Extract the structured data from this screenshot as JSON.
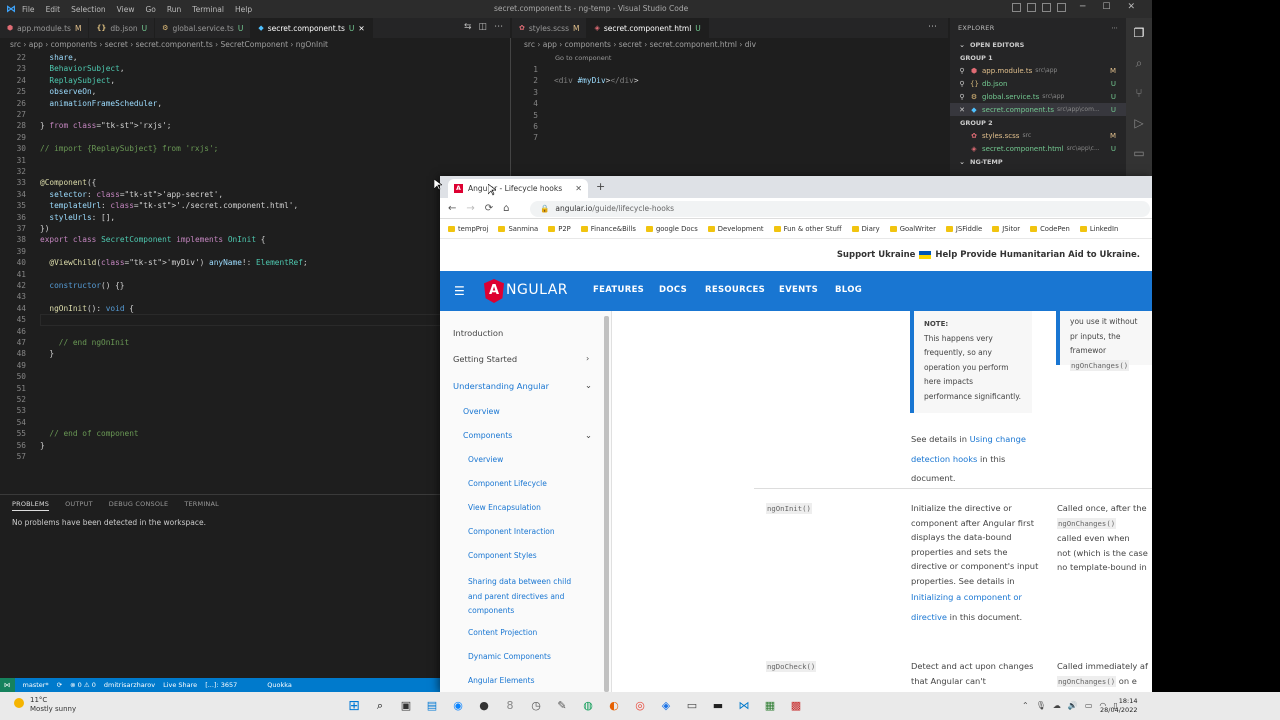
{
  "vscode": {
    "title": "secret.component.ts - ng-temp - Visual Studio Code",
    "menu": [
      "File",
      "Edit",
      "Selection",
      "View",
      "Go",
      "Run",
      "Terminal",
      "Help"
    ],
    "left_tabs": [
      {
        "label": "app.module.ts",
        "mark": "M",
        "color": "#e06c75",
        "icon": "angular-file-icon"
      },
      {
        "label": "db.json",
        "mark": "U",
        "color": "#d7ba7d",
        "icon": "json-file-icon"
      },
      {
        "label": "global.service.ts",
        "mark": "U",
        "color": "#e5c07b",
        "icon": "service-file-icon"
      },
      {
        "label": "secret.component.ts",
        "mark": "U",
        "color": "#4fc1ff",
        "icon": "component-file-icon"
      }
    ],
    "right_tabs": [
      {
        "label": "styles.scss",
        "mark": "M",
        "color": "#e06c75",
        "icon": "scss-file-icon"
      },
      {
        "label": "secret.component.html",
        "mark": "U",
        "color": "#e06c75",
        "icon": "html-file-icon"
      }
    ],
    "left_breadcrumb": "src › app › components › secret › secret.component.ts › SecretComponent › ngOnInit",
    "right_breadcrumb": "src › app › components › secret › secret.component.html › div",
    "go_to_component": "Go to component",
    "left_code": [
      {
        "n": "22",
        "t": "  share,"
      },
      {
        "n": "23",
        "t": "  BehaviorSubject,"
      },
      {
        "n": "24",
        "t": "  ReplaySubject,"
      },
      {
        "n": "25",
        "t": "  observeOn,"
      },
      {
        "n": "26",
        "t": "  animationFrameScheduler,"
      },
      {
        "n": "27",
        "t": ""
      },
      {
        "n": "28",
        "t": "} from 'rxjs';"
      },
      {
        "n": "29",
        "t": ""
      },
      {
        "n": "30",
        "t": "// import {ReplaySubject} from 'rxjs';"
      },
      {
        "n": "31",
        "t": ""
      },
      {
        "n": "32",
        "t": ""
      },
      {
        "n": "33",
        "t": "@Component({"
      },
      {
        "n": "34",
        "t": "  selector: 'app-secret',"
      },
      {
        "n": "35",
        "t": "  templateUrl: './secret.component.html',"
      },
      {
        "n": "36",
        "t": "  styleUrls: [],"
      },
      {
        "n": "37",
        "t": "})"
      },
      {
        "n": "38",
        "t": "export class SecretComponent implements OnInit {"
      },
      {
        "n": "39",
        "t": ""
      },
      {
        "n": "40",
        "t": "  @ViewChild('myDiv') anyName!: ElementRef;"
      },
      {
        "n": "41",
        "t": ""
      },
      {
        "n": "42",
        "t": "  constructor() {}"
      },
      {
        "n": "43",
        "t": ""
      },
      {
        "n": "44",
        "t": "  ngOnInit(): void {"
      },
      {
        "n": "45",
        "t": "  "
      },
      {
        "n": "46",
        "t": ""
      },
      {
        "n": "47",
        "t": "    // end ngOnInit"
      },
      {
        "n": "48",
        "t": "  }"
      },
      {
        "n": "49",
        "t": ""
      },
      {
        "n": "50",
        "t": ""
      },
      {
        "n": "51",
        "t": ""
      },
      {
        "n": "52",
        "t": ""
      },
      {
        "n": "53",
        "t": ""
      },
      {
        "n": "54",
        "t": ""
      },
      {
        "n": "55",
        "t": "  // end of component"
      },
      {
        "n": "56",
        "t": "}"
      },
      {
        "n": "57",
        "t": ""
      }
    ],
    "right_code": [
      {
        "n": "1",
        "t": ""
      },
      {
        "n": "2",
        "t": "<div #myDiv></div>"
      },
      {
        "n": "3",
        "t": ""
      },
      {
        "n": "4",
        "t": ""
      },
      {
        "n": "5",
        "t": ""
      },
      {
        "n": "6",
        "t": ""
      },
      {
        "n": "7",
        "t": ""
      }
    ],
    "panel_tabs": [
      "PROBLEMS",
      "OUTPUT",
      "DEBUG CONSOLE",
      "TERMINAL"
    ],
    "panel_message": "No problems have been detected in the workspace.",
    "explorer": {
      "title": "EXPLORER",
      "open_editors": "OPEN EDITORS",
      "group1": "GROUP 1",
      "group2": "GROUP 2",
      "ng_temp": "NG-TEMP",
      "items_g1": [
        {
          "name": "app.module.ts",
          "path": "src\\app",
          "status": "M",
          "color": "#e06c75"
        },
        {
          "name": "db.json",
          "path": "",
          "status": "U",
          "color": "#d7ba7d"
        },
        {
          "name": "global.service.ts",
          "path": "src\\app",
          "status": "U",
          "color": "#e5c07b"
        },
        {
          "name": "secret.component.ts",
          "path": "src\\app\\com...",
          "status": "U",
          "color": "#4fc1ff"
        }
      ],
      "items_g2": [
        {
          "name": "styles.scss",
          "path": "src",
          "status": "M",
          "color": "#e06c75"
        },
        {
          "name": "secret.component.html",
          "path": "src\\app\\c...",
          "status": "U",
          "color": "#e06c75"
        }
      ]
    },
    "status": {
      "branch": "master*",
      "errors": "⊗ 0 ⚠ 0",
      "user": "dmitrisarzharov",
      "live_share": "Live Share",
      "pos": "[...]: 3657",
      "quokka": "Quokka"
    }
  },
  "browser": {
    "tab_title": "Angular - Lifecycle hooks",
    "url_host": "angular.io",
    "url_path": "/guide/lifecycle-hooks",
    "bookmarks": [
      "tempProj",
      "Sanmina",
      "P2P",
      "Finance&Bills",
      "google Docs",
      "Development",
      "Fun & other Stuff",
      "Diary",
      "GoalWriter",
      "JSFiddle",
      "JSitor",
      "CodePen",
      "LinkedIn"
    ],
    "support_bold": "Support Ukraine",
    "support_link": "Help Provide Humanitarian Aid to Ukraine.",
    "brand": "NGULAR",
    "nav": [
      "FEATURES",
      "DOCS",
      "RESOURCES",
      "EVENTS",
      "BLOG"
    ],
    "sidebar": [
      "Introduction",
      "Getting Started",
      "Understanding Angular",
      "Overview",
      "Components",
      "Overview",
      "Component Lifecycle",
      "View Encapsulation",
      "Component Interaction",
      "Component Styles",
      "Sharing data between child and parent directives and components",
      "Content Projection",
      "Dynamic Components",
      "Angular Elements"
    ],
    "note_label": "NOTE:",
    "note_text": "This happens very frequently, so any operation you perform here impacts performance significantly.",
    "note2_text": "you use it without pr inputs, the framewor",
    "note2_code": "ngOnChanges()",
    "see1": "See details in ",
    "see1_link": "Using change detection hooks",
    "see1_end": " in this document.",
    "hook1": "ngOnInit()",
    "hook1_desc": "Initialize the directive or component after Angular first displays the data-bound properties and sets the directive or component's input properties. See details in ",
    "hook1_link": "Initializing a component or directive",
    "hook1_end": " in this document.",
    "hook1_timing_a": "Called once, after the",
    "hook1_timing_code": "ngOnChanges()",
    "hook1_timing_b": "called even when",
    "hook1_timing_c": "not (which is the case",
    "hook1_timing_d": "no template-bound in",
    "hook2": "ngDoCheck()",
    "hook2_desc": "Detect and act upon changes that Angular can't",
    "hook2_timing_a": "Called immediately af",
    "hook2_timing_code": "ngOnChanges()",
    "hook2_timing_b": "on e"
  },
  "taskbar": {
    "temp": "11°C",
    "weather": "Mostly sunny",
    "time": "18:14",
    "date": "28/04/2022"
  }
}
